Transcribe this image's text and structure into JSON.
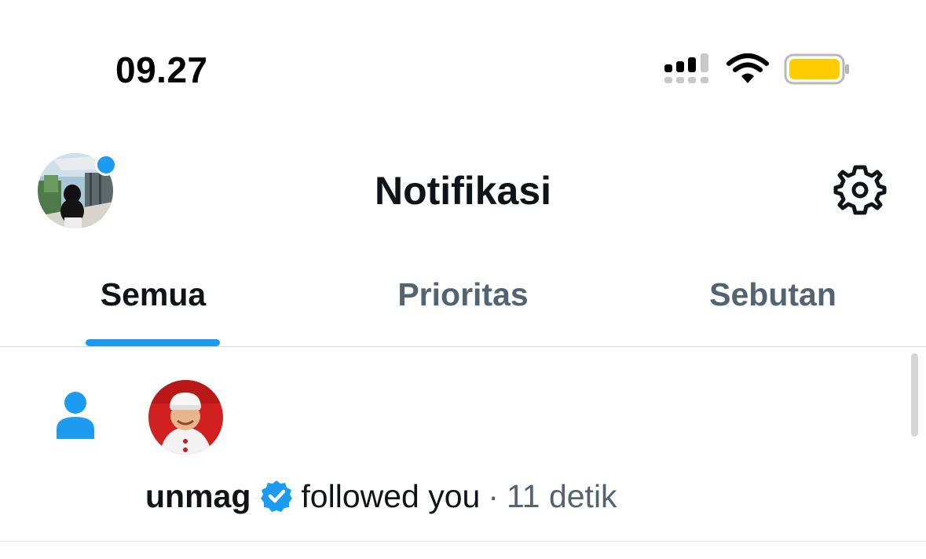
{
  "status_bar": {
    "time": "09.27",
    "icons": [
      "cellular-signal-icon",
      "wifi-icon",
      "battery-icon"
    ],
    "battery_color": "#ffcc00"
  },
  "header": {
    "title": "Notifikasi",
    "settings_icon": "gear-icon",
    "has_unread_dot": true
  },
  "tabs": [
    {
      "label": "Semua",
      "active": true
    },
    {
      "label": "Prioritas",
      "active": false
    },
    {
      "label": "Sebutan",
      "active": false
    }
  ],
  "notifications": [
    {
      "type_icon": "person-icon",
      "username": "unmag",
      "verified": true,
      "action": "followed you",
      "separator": "·",
      "time_ago": "11 detik"
    }
  ],
  "colors": {
    "accent": "#1d9bf0",
    "text_primary": "#0f1419",
    "text_secondary": "#536471"
  }
}
